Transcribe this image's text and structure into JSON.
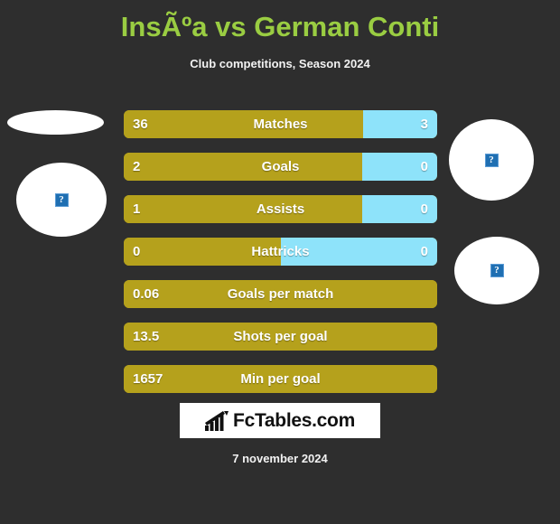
{
  "header": {
    "title": "InsÃºa vs German Conti",
    "subtitle": "Club competitions, Season 2024"
  },
  "players": {
    "left": {
      "photo_top_alt": "?",
      "photo_bottom_alt": "?"
    },
    "right": {
      "photo_top_alt": "?",
      "photo_bottom_alt": "?"
    }
  },
  "colors": {
    "background": "#2e2e2e",
    "title": "#9acd42",
    "bar_left": "#b5a11c",
    "bar_right": "#8ee3fa",
    "text": "#ffffff",
    "logo_background": "#ffffff"
  },
  "footer": {
    "logo_text": "FcTables.com",
    "date": "7 november 2024"
  },
  "chart_data": {
    "type": "bar",
    "title": "InsÃºa vs German Conti",
    "subtitle": "Club competitions, Season 2024",
    "orientation": "horizontal-diverging",
    "series": [
      {
        "name": "InsÃºa",
        "color": "#b5a11c"
      },
      {
        "name": "German Conti",
        "color": "#8ee3fa"
      }
    ],
    "categories": [
      "Matches",
      "Goals",
      "Assists",
      "Hattricks",
      "Goals per match",
      "Shots per goal",
      "Min per goal"
    ],
    "rows": [
      {
        "label": "Matches",
        "left_value": "36",
        "right_value": "3",
        "left_pct": 76.5,
        "right_pct": 23.5,
        "has_right": true
      },
      {
        "label": "Goals",
        "left_value": "2",
        "right_value": "0",
        "left_pct": 76.0,
        "right_pct": 24.0,
        "has_right": true
      },
      {
        "label": "Assists",
        "left_value": "1",
        "right_value": "0",
        "left_pct": 76.0,
        "right_pct": 24.0,
        "has_right": true
      },
      {
        "label": "Hattricks",
        "left_value": "0",
        "right_value": "0",
        "left_pct": 50.0,
        "right_pct": 50.0,
        "has_right": true
      },
      {
        "label": "Goals per match",
        "left_value": "0.06",
        "right_value": "",
        "left_pct": 100.0,
        "right_pct": 0.0,
        "has_right": false
      },
      {
        "label": "Shots per goal",
        "left_value": "13.5",
        "right_value": "",
        "left_pct": 100.0,
        "right_pct": 0.0,
        "has_right": false
      },
      {
        "label": "Min per goal",
        "left_value": "1657",
        "right_value": "",
        "left_pct": 100.0,
        "right_pct": 0.0,
        "has_right": false
      }
    ]
  }
}
